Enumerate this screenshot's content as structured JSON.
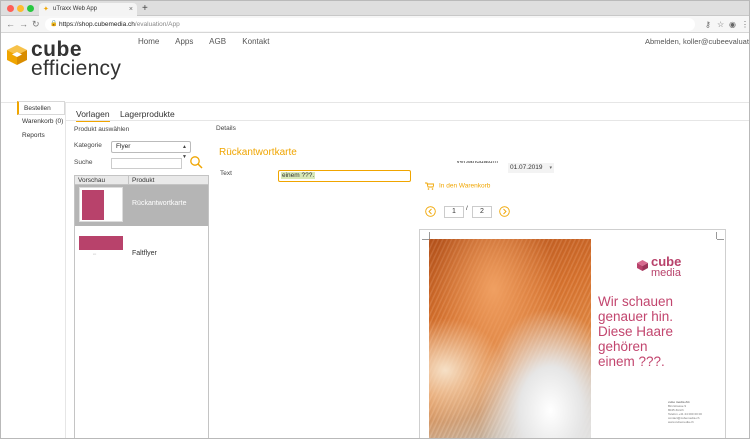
{
  "browser": {
    "tab_title": "uTraxx Web App",
    "tab_close": "×",
    "new_tab": "+",
    "url_host": "https://shop.cubemedia.ch",
    "url_path": "/evaluation/App"
  },
  "brand": {
    "logo_line1": "cube",
    "logo_line2": "efficiency",
    "accent_color": "#f0a500"
  },
  "topnav": {
    "items": [
      "Home",
      "Apps",
      "AGB",
      "Kontakt"
    ]
  },
  "user": {
    "links": "Abmelden, koller@cubeevaluation"
  },
  "sidenav": {
    "items": [
      "Bestellen",
      "Warenkorb (0)",
      "Reports"
    ]
  },
  "tabs": [
    "Vorlagen",
    "Lagerprodukte"
  ],
  "left": {
    "section_label": "Produkt auswählen",
    "category_label": "Kategorie",
    "category_value": "Flyer",
    "search_label": "Suche",
    "columns": [
      "Vorschau",
      "Produkt"
    ],
    "products": [
      "Rückantwortkarte",
      "Faltflyer"
    ]
  },
  "details": {
    "section_label": "Details",
    "title": "Rückantwortkarte",
    "text_label": "Text",
    "text_value": "einem ???.",
    "date_label": "Versanddatum",
    "date_value": "01.07.2019",
    "cart_label": "In den Warenkorb",
    "page_current": "1",
    "page_sep": "/",
    "page_total": "2"
  },
  "preview": {
    "brand_line1": "cube",
    "brand_line2": "media",
    "claim_lines": [
      "Wir schauen",
      "genauer hin.",
      "Diese Haare",
      "gehören",
      "einem ???."
    ],
    "address_lines": [
      "cube media AG",
      "Binzstrasse 9",
      "8045 Zürich",
      "Telefon +41 44 000 00 00",
      "contact@cubemedia.ch",
      "www.cubemedia.ch"
    ],
    "claim_color": "#c2456e"
  }
}
